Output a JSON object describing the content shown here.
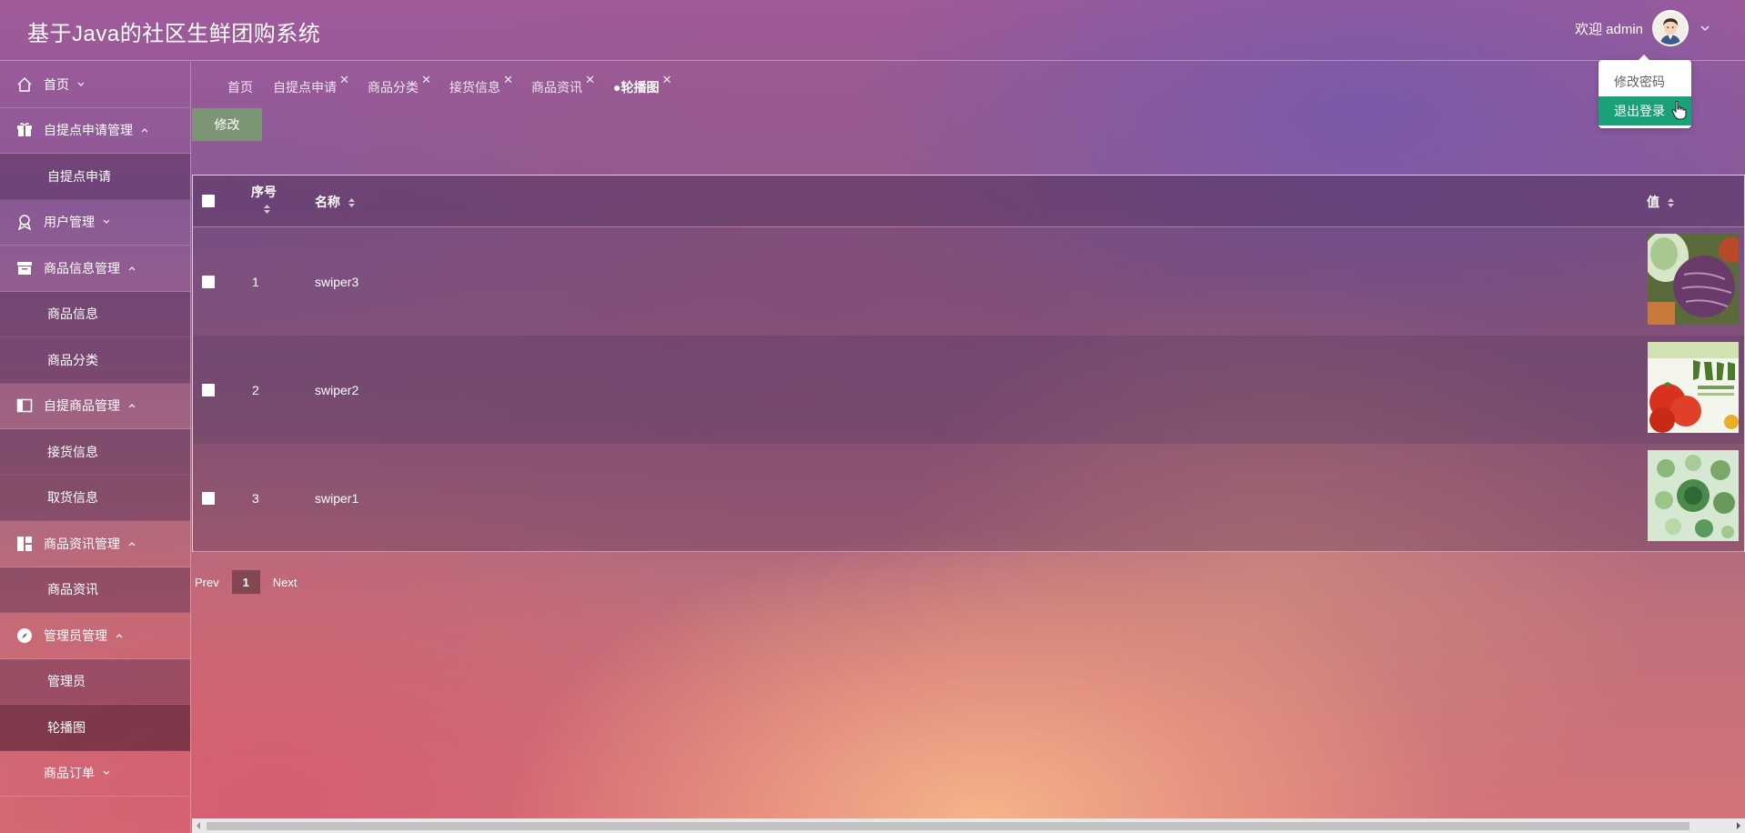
{
  "header": {
    "title": "基于Java的社区生鲜团购系统",
    "welcome": "欢迎 admin"
  },
  "user_menu": {
    "items": [
      "修改密码",
      "退出登录"
    ]
  },
  "sidebar": {
    "items": [
      {
        "label": "首页",
        "icon": "home-icon"
      },
      {
        "label": "自提点申请管理",
        "icon": "gift-icon"
      },
      {
        "label": "自提点申请",
        "sub": true
      },
      {
        "label": "用户管理",
        "icon": "user-badge-icon"
      },
      {
        "label": "商品信息管理",
        "icon": "box-icon"
      },
      {
        "label": "商品信息",
        "sub": true
      },
      {
        "label": "商品分类",
        "sub": true
      },
      {
        "label": "自提商品管理",
        "icon": "panel-icon"
      },
      {
        "label": "接货信息",
        "sub": true
      },
      {
        "label": "取货信息",
        "sub": true
      },
      {
        "label": "商品资讯管理",
        "icon": "grid-icon"
      },
      {
        "label": "商品资讯",
        "sub": true
      },
      {
        "label": "管理员管理",
        "icon": "compass-icon"
      },
      {
        "label": "管理员",
        "sub": true
      },
      {
        "label": "轮播图",
        "sub": true,
        "active": true
      },
      {
        "label": "商品订单"
      }
    ]
  },
  "tabs": [
    {
      "label": "首页"
    },
    {
      "label": "自提点申请"
    },
    {
      "label": "商品分类"
    },
    {
      "label": "接货信息"
    },
    {
      "label": "商品资讯"
    },
    {
      "label": "●轮播图",
      "active": true
    }
  ],
  "toolbar": {
    "edit_label": "修改"
  },
  "table": {
    "headers": {
      "index": "序号",
      "name": "名称",
      "value": "值"
    },
    "rows": [
      {
        "index": "1",
        "name": "swiper3",
        "image": "purple-cabbage-vegetables"
      },
      {
        "index": "2",
        "name": "swiper2",
        "image": "tomatoes-fresh-fruit-plan"
      },
      {
        "index": "3",
        "name": "swiper1",
        "image": "green-vegetables-pattern"
      }
    ]
  },
  "pagination": {
    "prev": "Prev",
    "current": "1",
    "next": "Next"
  },
  "colors": {
    "accent_green": "#1aa179",
    "edit_button": "#78a06e"
  }
}
